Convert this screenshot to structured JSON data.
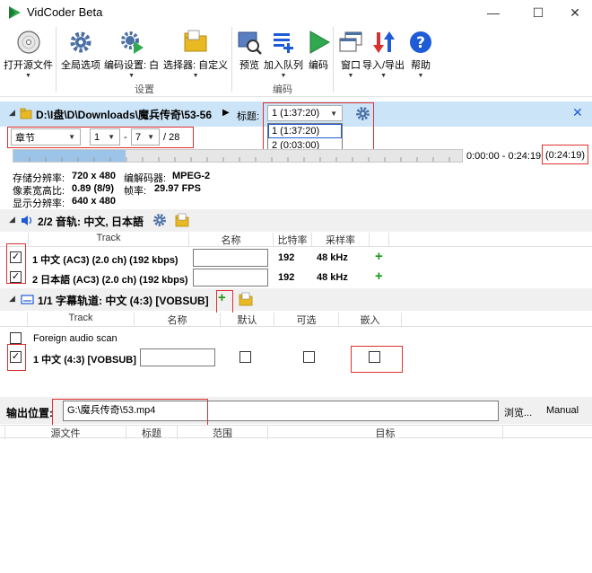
{
  "window": {
    "title": "VidCoder Beta",
    "minimize": "—",
    "maximize": "☐",
    "close": "✕"
  },
  "toolbar": {
    "open_source": "打开源文件",
    "global_options": "全局选项",
    "encoding_settings": "编码设置: 白",
    "picker": "选择器: 自定义",
    "preview": "预览",
    "add_queue": "加入队列",
    "encode": "编码",
    "window": "窗口",
    "import_export": "导入/导出",
    "help": "帮助",
    "group_settings": "设置",
    "group_encode": "编码"
  },
  "source": {
    "path": "D:\\I盘\\D\\Downloads\\魔兵传奇\\53-56",
    "title_label": "标题:",
    "title_value": "1 (1:37:20)",
    "title_options": [
      "1 (1:37:20)",
      "2 (0:03:00)"
    ],
    "close": "✕"
  },
  "range": {
    "mode": "章节",
    "start": "1",
    "dash": "-",
    "end": "7",
    "total": "/ 28",
    "time_range": "0:00:00 - 0:24:19",
    "duration": "(0:24:19)",
    "fraction_selected": 0.25
  },
  "info": {
    "storage_res_label": "存储分辨率:",
    "storage_res": "720 x 480",
    "decoder_label": "编解码器:",
    "decoder": "MPEG-2",
    "par_label": "像素宽高比:",
    "par": "0.89 (8/9)",
    "fps_label": "帧率:",
    "fps": "29.97 FPS",
    "display_res_label": "显示分辨率:",
    "display_res": "640 x 480"
  },
  "audio": {
    "header": "2/2 音轨: 中文, 日本語",
    "columns": [
      "Track",
      "名称",
      "比特率",
      "采样率"
    ],
    "rows": [
      {
        "track": "1 中文 (AC3) (2.0 ch) (192 kbps)",
        "bitrate": "192",
        "samplerate": "48 kHz",
        "checked": "✓"
      },
      {
        "track": "2 日本語 (AC3) (2.0 ch) (192 kbps)",
        "bitrate": "192",
        "samplerate": "48 kHz",
        "checked": "✓"
      }
    ],
    "add": "+"
  },
  "subtitles": {
    "header": "1/1 字幕轨道: 中文 (4:3) [VOBSUB]",
    "add": "+",
    "columns": [
      "Track",
      "名称",
      "默认",
      "可选",
      "嵌入"
    ],
    "foreign": "Foreign audio scan",
    "rows": [
      {
        "track": "1 中文 (4:3) [VOBSUB]",
        "checked": "✓"
      }
    ]
  },
  "output": {
    "label": "输出位置:",
    "path": "G:\\魔兵传奇\\53.mp4",
    "browse": "浏览...",
    "manual": "Manual"
  },
  "queue": {
    "columns": [
      "源文件",
      "标题",
      "范围",
      "目标"
    ]
  },
  "colors": {
    "accent_blue": "#1e5bd6",
    "source_bar": "#cce4f7",
    "red_highlight": "#e03030",
    "green": "#1a9a1a"
  }
}
